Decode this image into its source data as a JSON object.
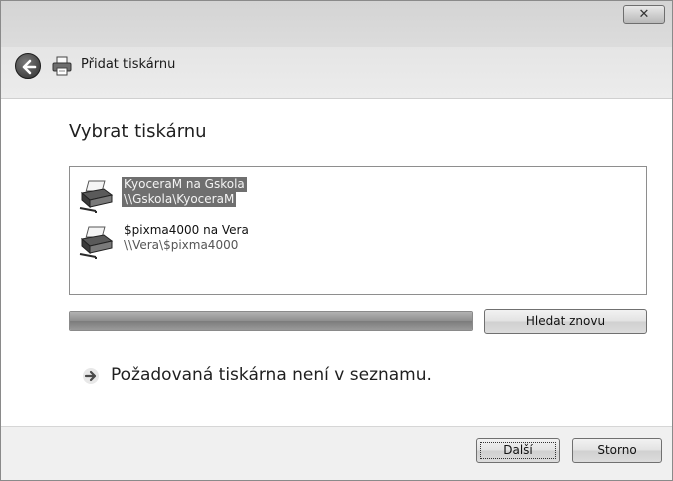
{
  "window": {
    "title": "Přidat tiskárnu",
    "close_label": "✕"
  },
  "page": {
    "heading": "Vybrat tiskárnu"
  },
  "printers": [
    {
      "name": "KyoceraM na Gskola",
      "path": "\\\\Gskola\\KyoceraM",
      "selected": true
    },
    {
      "name": "$pixma4000 na Vera",
      "path": "\\\\Vera\\$pixma4000",
      "selected": false
    }
  ],
  "search": {
    "progress": 1.0,
    "button_label": "Hledat znovu"
  },
  "link": {
    "text": "Požadovaná tiskárna není v seznamu."
  },
  "footer": {
    "next_label": "Další",
    "cancel_label": "Storno"
  },
  "icons": {
    "back": "back-arrow-icon",
    "title_printer": "printer-icon",
    "list_printer": "network-printer-icon",
    "link_arrow": "arrow-right-icon"
  }
}
